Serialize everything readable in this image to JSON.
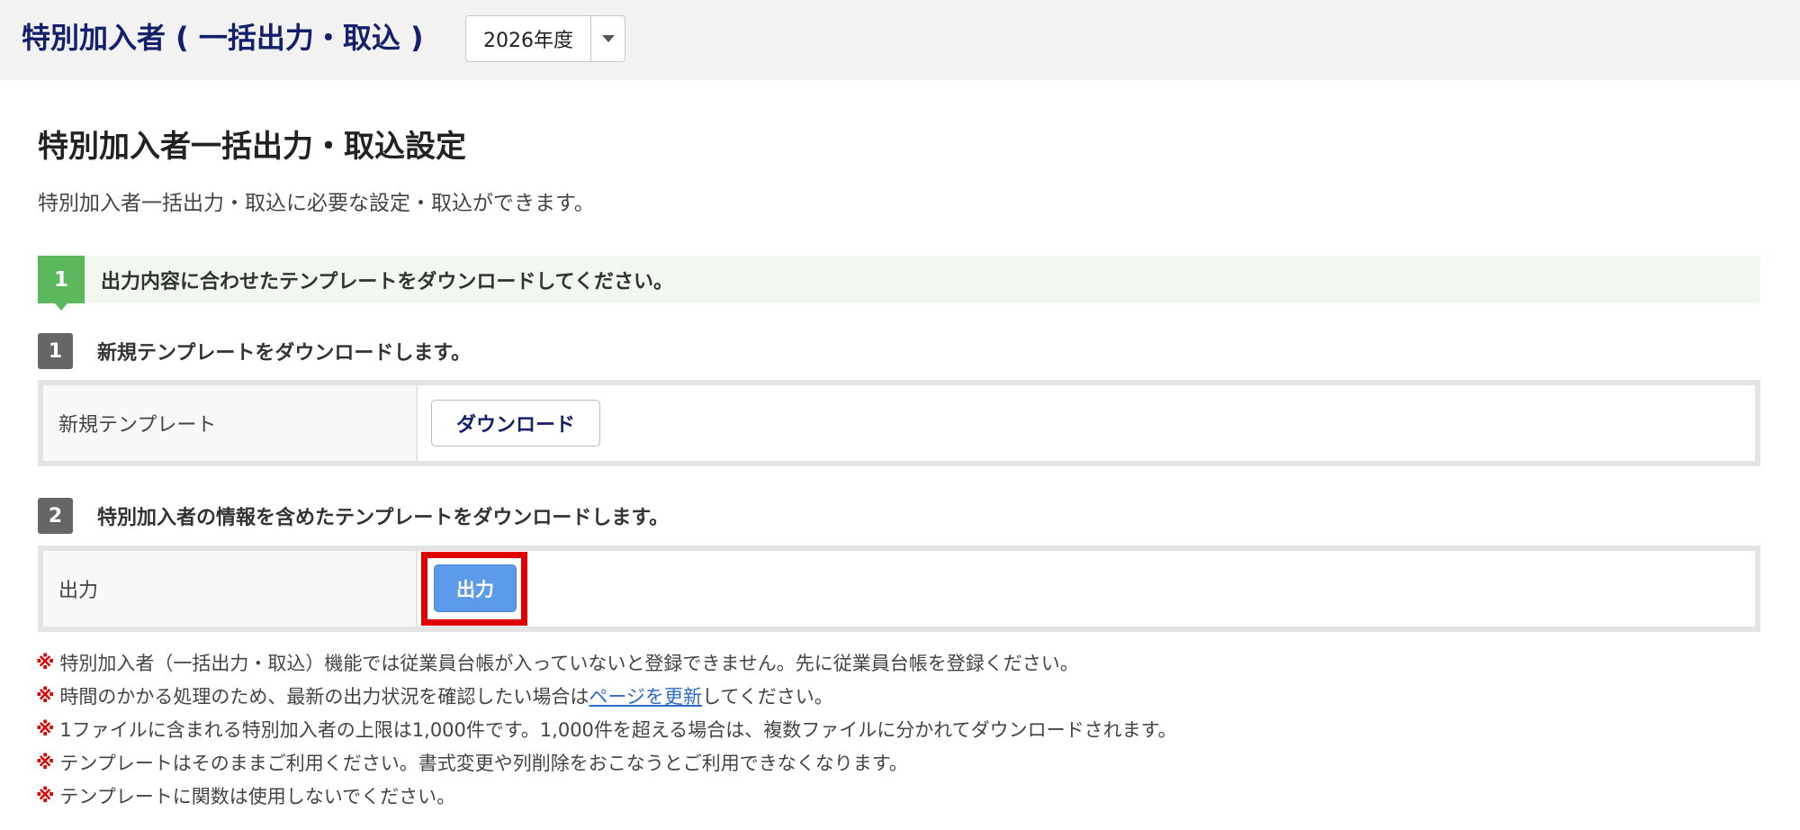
{
  "header": {
    "title": "特別加入者 ( 一括出力・取込 )",
    "year_select": {
      "value": "2026年度",
      "caret_icon": "caret-down-icon"
    }
  },
  "main": {
    "title": "特別加入者一括出力・取込設定",
    "description": "特別加入者一括出力・取込に必要な設定・取込ができます。"
  },
  "step1": {
    "number": "1",
    "text": "出力内容に合わせたテンプレートをダウンロードしてください。"
  },
  "substeps": [
    {
      "number": "1",
      "text": "新規テンプレートをダウンロードします。",
      "row_label": "新規テンプレート",
      "button_label": "ダウンロード"
    },
    {
      "number": "2",
      "text": "特別加入者の情報を含めたテンプレートをダウンロードします。",
      "row_label": "出力",
      "button_label": "出力"
    }
  ],
  "notes": {
    "mark": "※",
    "items": [
      "特別加入者（一括出力・取込）機能では従業員台帳が入っていないと登録できません。先に従業員台帳を登録ください。",
      {
        "before": "時間のかかる処理のため、最新の出力状況を確認したい場合は",
        "link": "ページを更新",
        "after": "してください。"
      },
      "1ファイルに含まれる特別加入者の上限は1,000件です。1,000件を超える場合は、複数ファイルに分かれてダウンロードされます。",
      "テンプレートはそのままご利用ください。書式変更や列削除をおこなうとご利用できなくなります。",
      "テンプレートに関数は使用しないでください。"
    ]
  },
  "colors": {
    "header_title": "#15206b",
    "step_green": "#5cb85c",
    "substep_gray": "#666666",
    "primary_button": "#5b9bea",
    "highlight_red": "#e00000",
    "note_mark": "#e00000",
    "link": "#2e6bc4"
  }
}
